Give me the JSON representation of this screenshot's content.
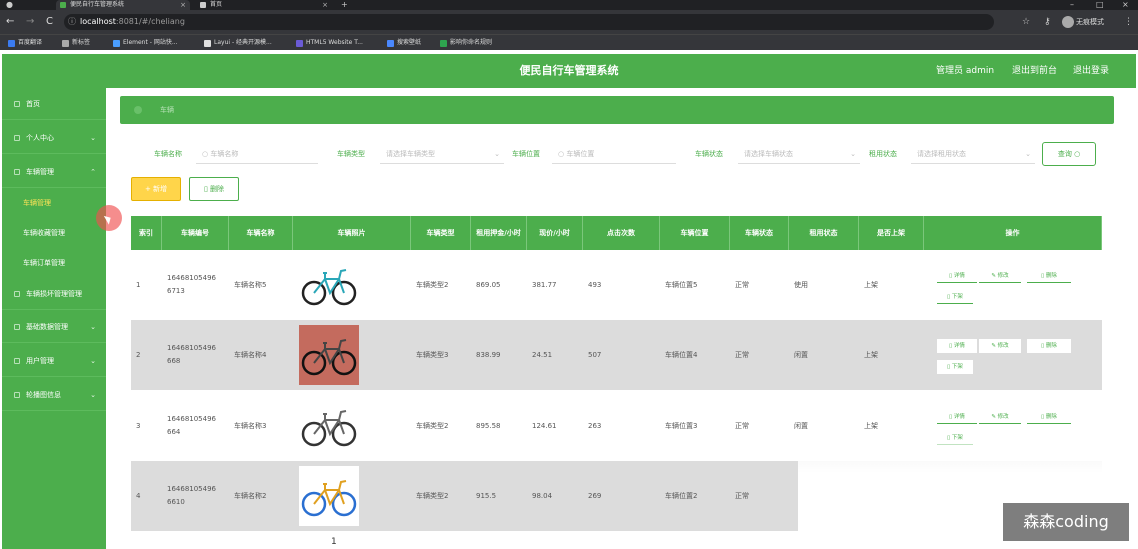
{
  "browser": {
    "tabs": [
      {
        "title": "便民自行车管理系统",
        "active": true
      },
      {
        "title": "首页",
        "active": false
      }
    ],
    "new_tab": "+",
    "url_host": "localhost",
    "url_path": ":8081/#/cheliang",
    "incognito_label": "无痕模式",
    "bookmarks": [
      {
        "label": "百度翻译",
        "color": "#3b7bf0"
      },
      {
        "label": "新标签",
        "color": "#aaaaaa"
      },
      {
        "label": "Element - 网站快...",
        "color": "#4a9eff"
      },
      {
        "label": "Layui - 经典开源模...",
        "color": "#e0e0e0"
      },
      {
        "label": "HTML5 Website T...",
        "color": "#6b5bd6"
      },
      {
        "label": "搜索壁纸",
        "color": "#4a88ff"
      },
      {
        "label": "影响你命名规则",
        "color": "#2ea44f"
      }
    ]
  },
  "header": {
    "title": "便民自行车管理系统",
    "admin": "管理员 admin",
    "back_to_front": "退出到前台",
    "logout": "退出登录"
  },
  "sidebar": {
    "items": [
      {
        "label": "首页",
        "chevron": ""
      },
      {
        "label": "个人中心",
        "chevron": "⌄"
      },
      {
        "label": "车辆管理",
        "chevron": "⌃"
      }
    ],
    "sub_items": [
      {
        "label": "车辆管理",
        "active": true
      },
      {
        "label": "车辆收藏管理",
        "active": false
      },
      {
        "label": "车辆订单管理",
        "active": false
      }
    ],
    "items_after": [
      {
        "label": "车辆损坏管理管理",
        "chevron": ""
      },
      {
        "label": "基础数据管理",
        "chevron": "⌄"
      },
      {
        "label": "用户管理",
        "chevron": "⌄"
      },
      {
        "label": "轮播图信息",
        "chevron": "⌄"
      }
    ]
  },
  "breadcrumb": "车辆",
  "filters": {
    "name_label": "车辆名称",
    "name_placeholder": "车辆名称",
    "type_label": "车辆类型",
    "type_placeholder": "请选择车辆类型",
    "location_label": "车辆位置",
    "location_placeholder": "车辆位置",
    "status_label": "车辆状态",
    "status_placeholder": "请选择车辆状态",
    "rent_label": "租用状态",
    "rent_placeholder": "请选择租用状态",
    "query_button": "查询"
  },
  "actions": {
    "add": "+ 新增",
    "delete": "删除"
  },
  "table": {
    "headers": [
      "索引",
      "车辆编号",
      "车辆名称",
      "车辆照片",
      "车辆类型",
      "租用押金/小时",
      "现价/小时",
      "点击次数",
      "车辆位置",
      "车辆状态",
      "租用状态",
      "是否上架",
      "操作"
    ],
    "rows": [
      {
        "index": "1",
        "code": "16468105496\n6713",
        "name": "车辆名称5",
        "image": "bike-dark",
        "type": "车辆类型2",
        "deposit": "869.05",
        "price": "381.77",
        "clicks": "493",
        "location": "车辆位置5",
        "status": "正常",
        "rent": "使用",
        "shelf": "上架"
      },
      {
        "index": "2",
        "code": "16468105496\n668",
        "name": "车辆名称4",
        "image": "bike-red",
        "type": "车辆类型3",
        "deposit": "838.99",
        "price": "24.51",
        "clicks": "507",
        "location": "车辆位置4",
        "status": "正常",
        "rent": "闲置",
        "shelf": "上架"
      },
      {
        "index": "3",
        "code": "16468105496\n664",
        "name": "车辆名称3",
        "image": "bike-black",
        "type": "车辆类型2",
        "deposit": "895.58",
        "price": "124.61",
        "clicks": "263",
        "location": "车辆位置3",
        "status": "正常",
        "rent": "闲置",
        "shelf": "上架"
      },
      {
        "index": "4",
        "code": "16468105496\n6610",
        "name": "车辆名称2",
        "image": "bike-blue",
        "type": "车辆类型2",
        "deposit": "915.5",
        "price": "98.04",
        "clicks": "269",
        "location": "车辆位置2",
        "status": "正常",
        "rent": "",
        "shelf": ""
      }
    ],
    "row_actions": {
      "detail": "详情",
      "edit": "修改",
      "delete": "删除",
      "offshelf": "下架"
    }
  },
  "pagination": {
    "current": "1"
  },
  "watermark": "森森coding",
  "colors": {
    "primary": "#4cae4c",
    "accent": "#ffd54a",
    "row_alt": "#dcdcdc"
  }
}
